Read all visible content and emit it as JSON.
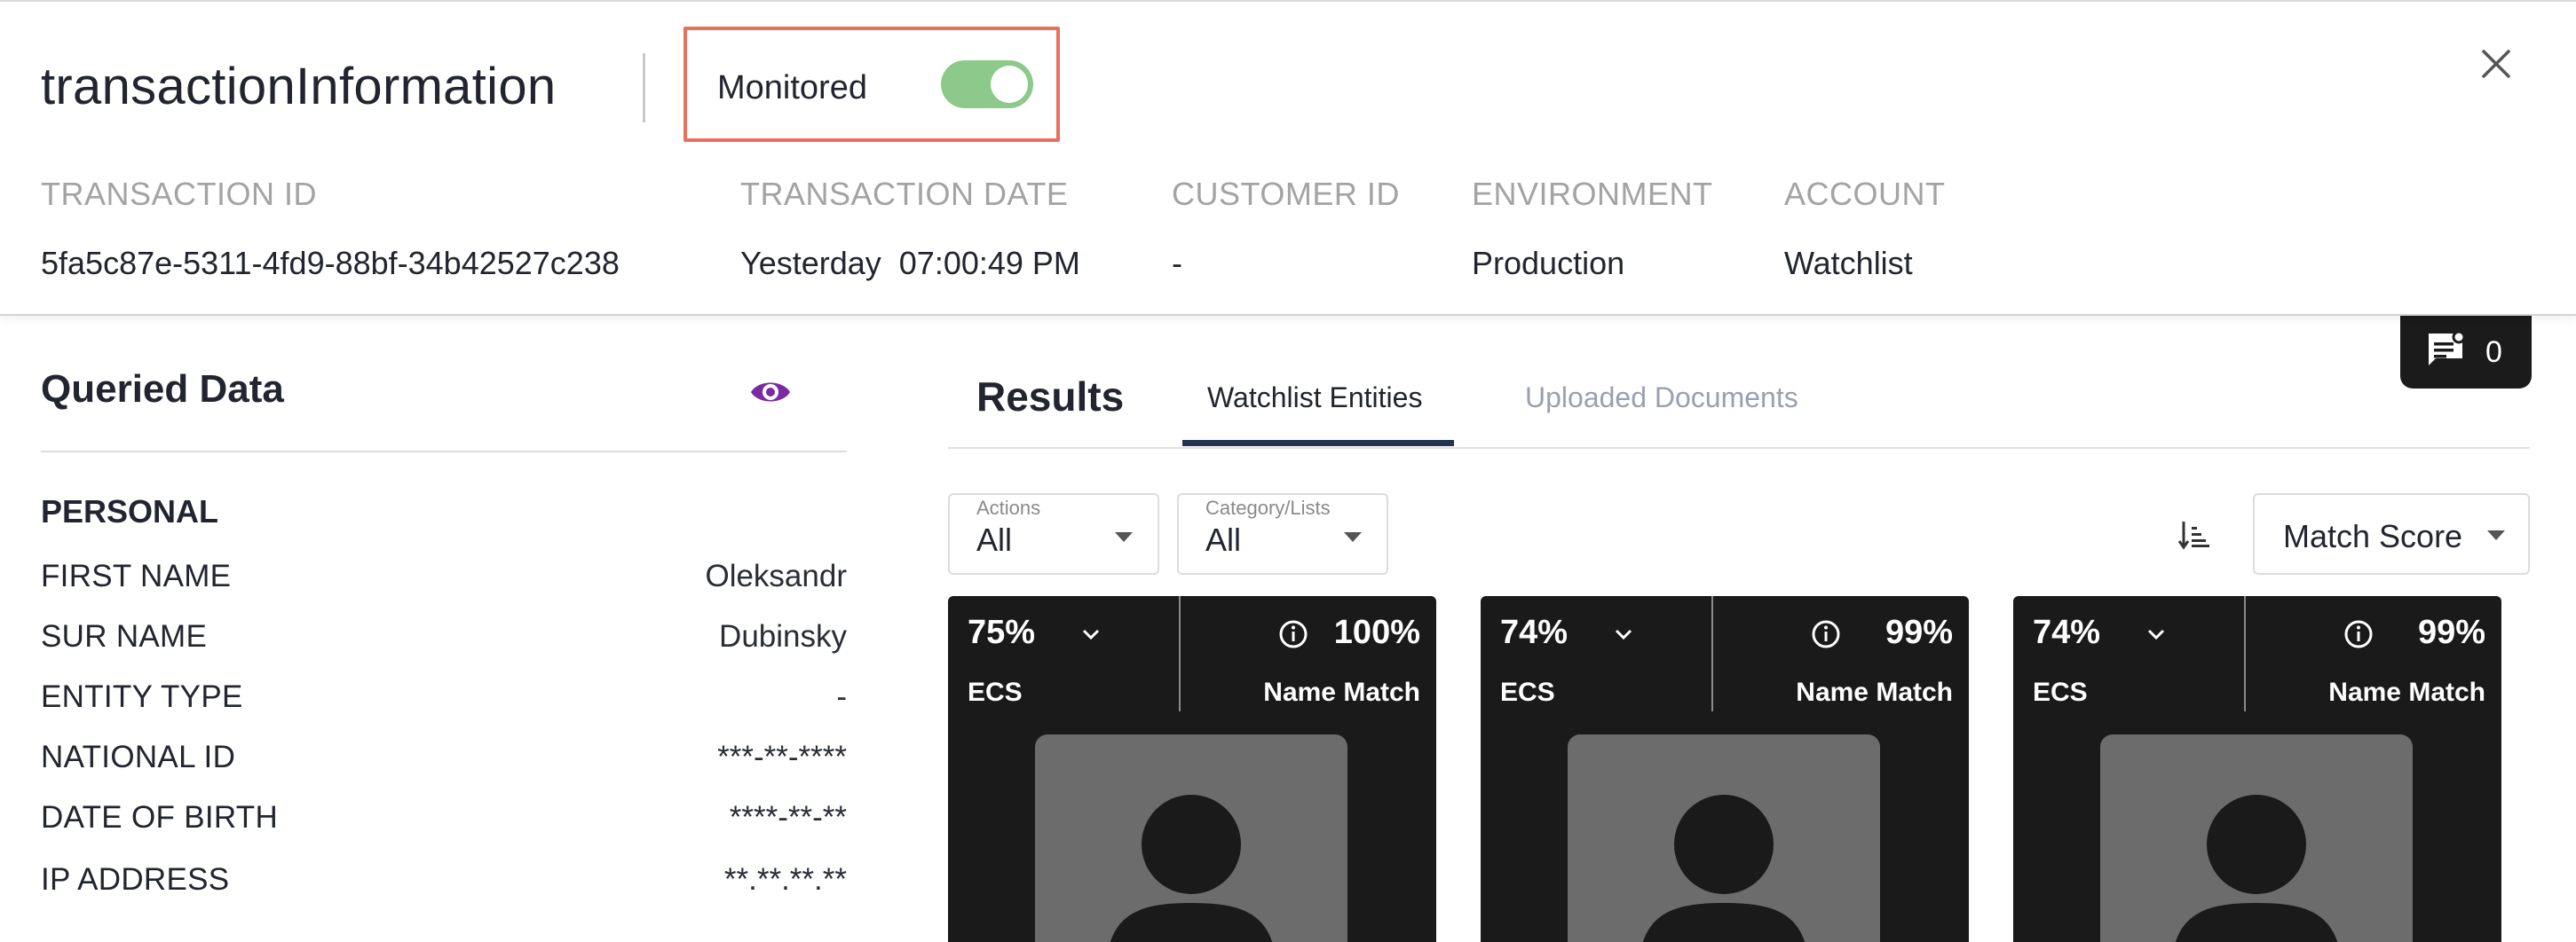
{
  "header": {
    "title": "transactionInformation",
    "monitored_label": "Monitored",
    "monitored_on": true,
    "meta": [
      {
        "label": "TRANSACTION ID",
        "value": "5fa5c87e-5311-4fd9-88bf-34b42527c238"
      },
      {
        "label": "TRANSACTION DATE",
        "value": "Yesterday  07:00:49 PM"
      },
      {
        "label": "CUSTOMER ID",
        "value": "-"
      },
      {
        "label": "ENVIRONMENT",
        "value": "Production"
      },
      {
        "label": "ACCOUNT",
        "value": "Watchlist"
      }
    ]
  },
  "queried": {
    "title": "Queried Data",
    "section": "PERSONAL",
    "fields": [
      {
        "label": "FIRST NAME",
        "value": "Oleksandr"
      },
      {
        "label": "SUR NAME",
        "value": "Dubinsky"
      },
      {
        "label": "ENTITY TYPE",
        "value": "-"
      },
      {
        "label": "NATIONAL ID",
        "value": "***-**-****"
      },
      {
        "label": "DATE OF BIRTH",
        "value": "****-**-**"
      },
      {
        "label": "IP ADDRESS",
        "value": "**.**.**.**"
      }
    ]
  },
  "results": {
    "title": "Results",
    "tabs": [
      {
        "label": "Watchlist Entities",
        "active": true
      },
      {
        "label": "Uploaded Documents",
        "active": false
      }
    ],
    "comments_count": "0",
    "filters": [
      {
        "label": "Actions",
        "value": "All"
      },
      {
        "label": "Category/Lists",
        "value": "All"
      }
    ],
    "sort_value": "Match Score",
    "cards": [
      {
        "ecs_pct": "75%",
        "ecs_label": "ECS",
        "name_pct": "100%",
        "name_label": "Name Match"
      },
      {
        "ecs_pct": "74%",
        "ecs_label": "ECS",
        "name_pct": "99%",
        "name_label": "Name Match"
      },
      {
        "ecs_pct": "74%",
        "ecs_label": "ECS",
        "name_pct": "99%",
        "name_label": "Name Match"
      }
    ]
  },
  "colors": {
    "toggle_on": "#8cc98a",
    "highlight_border": "#e8715c",
    "eye_icon": "#7b2aa0",
    "tab_underline": "#243350",
    "card_bg": "#1a1a1a"
  }
}
